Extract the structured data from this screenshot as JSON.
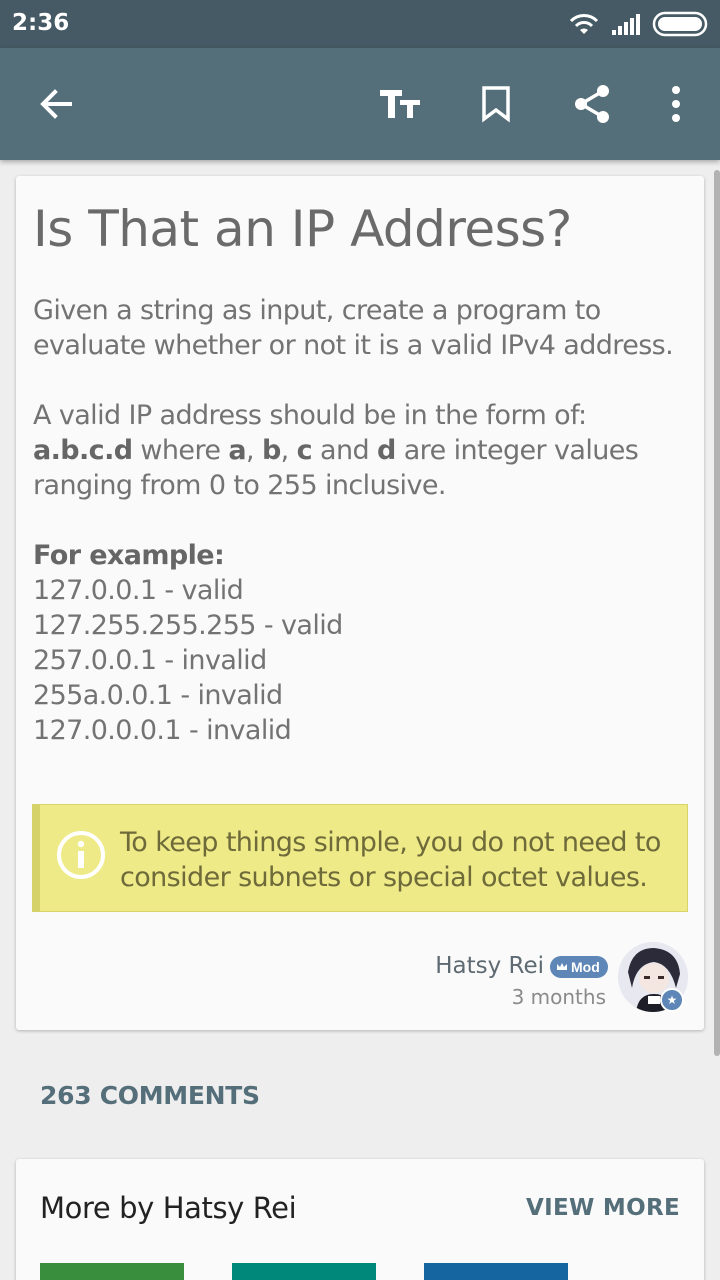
{
  "status_bar": {
    "time": "2:36"
  },
  "toolbar": {
    "back": "back-arrow-icon",
    "text_size": "text-size-icon",
    "bookmark": "bookmark-icon",
    "share": "share-icon",
    "more": "more-vert-icon"
  },
  "post": {
    "title": "Is That an IP Address?",
    "intro": "Given a string as input, create a program to evaluate whether or not it is a valid IPv4 address.",
    "form_line": "A valid IP address should be in the form of:",
    "form_abcd": "a.b.c.d",
    "form_where": " where ",
    "form_a": "a",
    "form_comma1": ", ",
    "form_b": "b",
    "form_comma2": ", ",
    "form_c": "c",
    "form_and": " and ",
    "form_d": "d",
    "form_rest": " are integer values ranging from 0 to 255 inclusive.",
    "example_heading": "For example:",
    "examples": [
      "127.0.0.1 - valid",
      "127.255.255.255 - valid",
      "257.0.0.1 - invalid",
      "255a.0.0.1 - invalid",
      "127.0.0.0.1 - invalid"
    ],
    "note": "To keep things simple, you do not need to consider subnets or special octet values.",
    "author": "Hatsy Rei",
    "author_badge": "Mod",
    "time": "3 months"
  },
  "comments_label": "263 COMMENTS",
  "more_by": {
    "title": "More by Hatsy Rei",
    "view_more": "VIEW MORE",
    "thumb_colors": [
      "#388e3c",
      "#00897b",
      "#1565a0"
    ]
  },
  "colors": {
    "status_bar": "#455a64",
    "app_bar": "#546e7a",
    "note_bg": "#eeea88",
    "badge": "#5e86b6"
  }
}
